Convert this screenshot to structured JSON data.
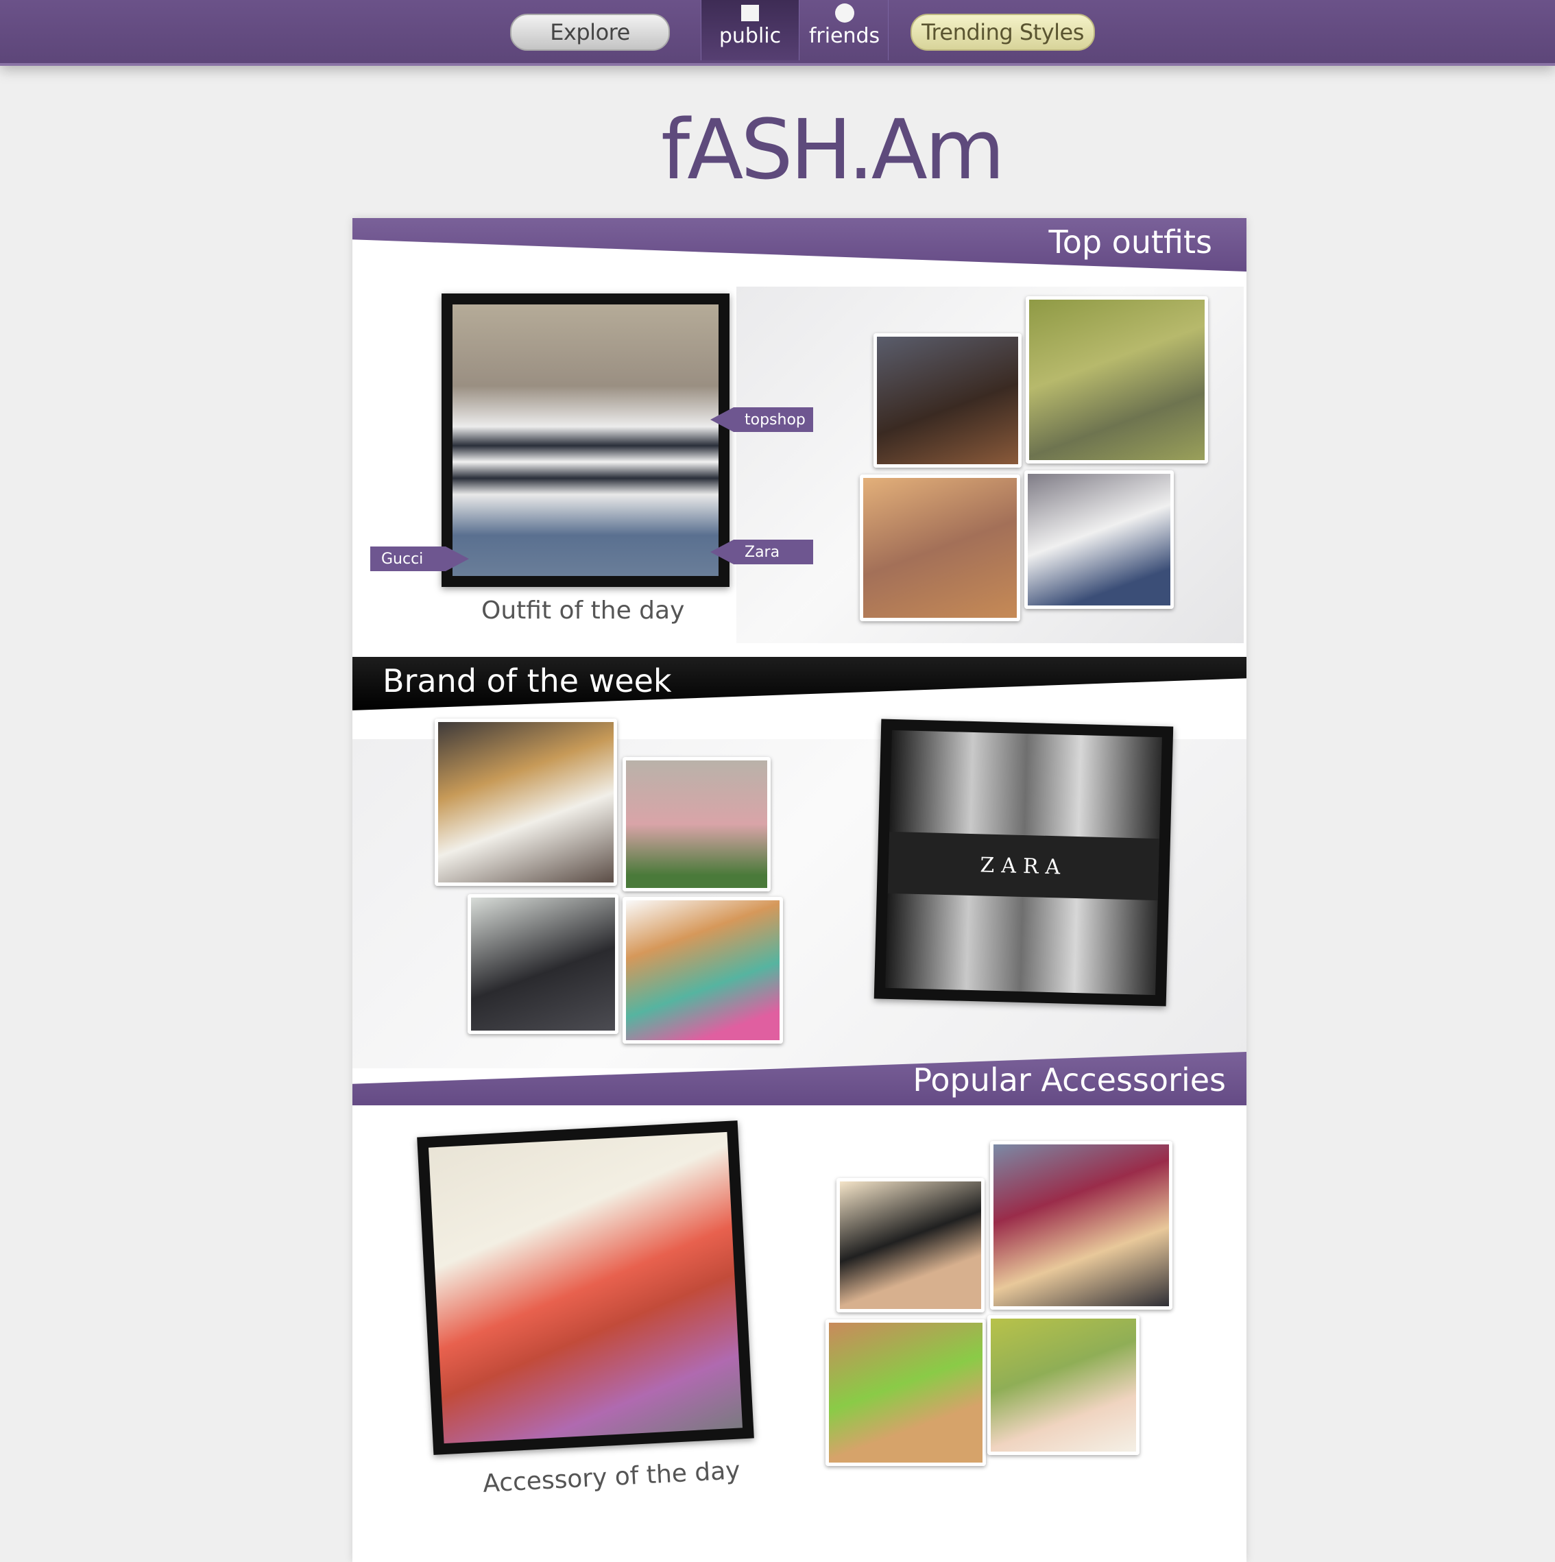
{
  "nav": {
    "explore_label": "Explore",
    "public_label": "public",
    "friends_label": "friends",
    "trending_label": "Trending Styles",
    "public_icon": "square-icon",
    "friends_icon": "circle-icon"
  },
  "logo": {
    "text": "fASH.Am"
  },
  "sections": {
    "top_outfits": {
      "title": "Top outfits",
      "caption": "Outfit of the day",
      "tags": [
        "topshop",
        "Gucci",
        "Zara"
      ]
    },
    "brand_of_week": {
      "title": "Brand of the week",
      "brand_logo": "ZARA"
    },
    "popular_accessories": {
      "title": "Popular Accessories",
      "caption": "Accessory of the day"
    }
  },
  "colors": {
    "brand_purple": "#654b85",
    "logo_purple": "#5e4a7c",
    "trending_pill": "#d8d49a",
    "explore_pill": "#c4c4c4"
  }
}
